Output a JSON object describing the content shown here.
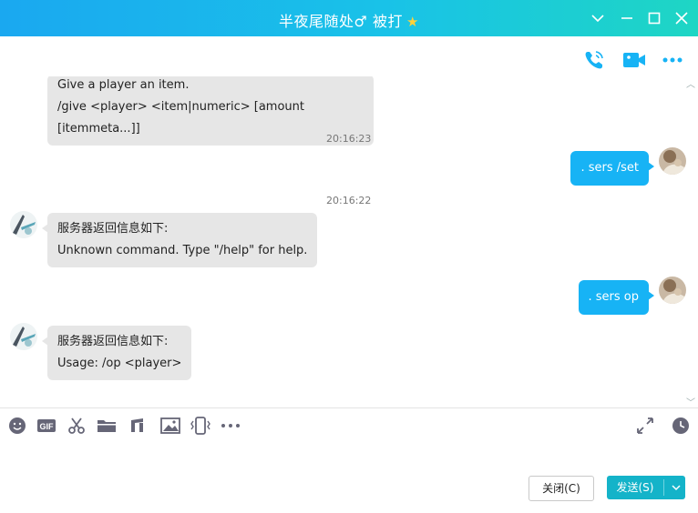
{
  "window": {
    "title": "半夜尾随处♂ 被打",
    "title_icon": "star-icon",
    "controls": [
      "chevron-down-icon",
      "minimize-icon",
      "maximize-icon",
      "close-icon"
    ]
  },
  "callbar": {
    "icons": [
      "phone-call-icon",
      "video-call-icon",
      "more-dots-icon"
    ]
  },
  "messages": [
    {
      "side": "in",
      "lines": [
        "Give a player an item.",
        "/give <player> <item|numeric> [amount [itemmeta...]]"
      ]
    },
    {
      "time": "20:16:23"
    },
    {
      "side": "out",
      "text": ". sers /set"
    },
    {
      "time": "20:16:22"
    },
    {
      "side": "in",
      "lines": [
        "服务器返回信息如下:",
        "Unknown command. Type \"/help\" for help."
      ]
    },
    {
      "side": "out",
      "text": ". sers op"
    },
    {
      "side": "in",
      "lines": [
        "服务器返回信息如下:",
        "Usage: /op <player>"
      ]
    }
  ],
  "toolbar": {
    "icons": [
      "emoji-icon",
      "gif-icon",
      "scissors-icon",
      "folder-icon",
      "music-icon",
      "image-icon",
      "phone-shake-icon",
      "more-dots-icon"
    ],
    "right_icons": [
      "expand-icon",
      "history-clock-icon"
    ]
  },
  "buttons": {
    "close_label": "关闭(C)",
    "send_label": "发送(S)"
  },
  "colors": {
    "accent": "#17b3f5",
    "send_button": "#14b3c9",
    "title_gradient_start": "#1aa8f0",
    "title_gradient_end": "#1ed6c4"
  }
}
